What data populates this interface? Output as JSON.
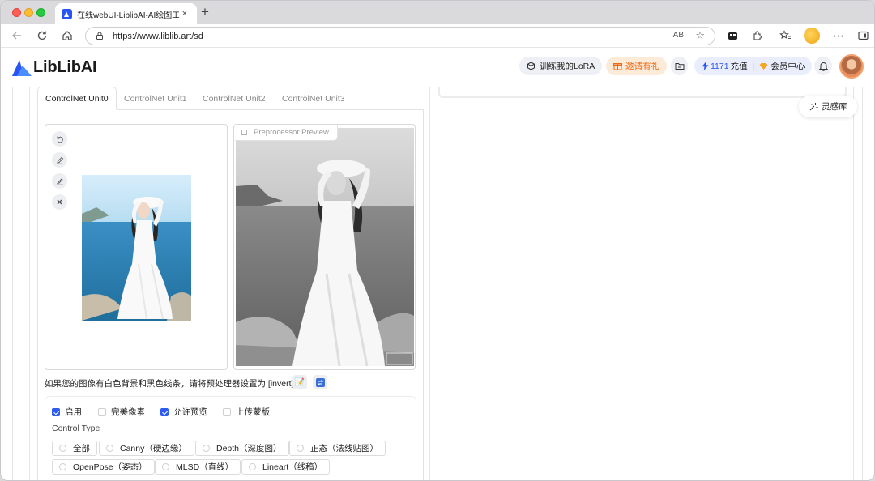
{
  "browser": {
    "tab_title": "在线webUI-LiblibAI-AI绘图工具",
    "tab_close": "×",
    "new_tab": "+",
    "url": "https://www.liblib.art/sd",
    "reader_mode": "AB"
  },
  "header": {
    "logo_text": "LibLibAI",
    "train_lora": "训练我的LoRA",
    "invite": "邀请有礼",
    "credits_value": "1171",
    "recharge": "充值",
    "member_center": "会员中心"
  },
  "inspiration_label": "灵感库",
  "controlnet": {
    "tabs": [
      "ControlNet Unit0",
      "ControlNet Unit1",
      "ControlNet Unit2",
      "ControlNet Unit3"
    ],
    "active_tab": 0,
    "preprocessor_preview_label": "Preprocessor Preview",
    "invert_hint": "如果您的图像有白色背景和黑色线条，请将预处理器设置为 [invert].",
    "options": {
      "enable": "启用",
      "pixel_perfect": "完美像素",
      "allow_preview": "允许预览",
      "upload_mask": "上传蒙版",
      "enable_checked": true,
      "pixel_perfect_checked": false,
      "allow_preview_checked": true,
      "upload_mask_checked": false
    },
    "control_type_label": "Control Type",
    "control_types": [
      "全部",
      "Canny（硬边缘）",
      "Depth（深度图）",
      "正态（法线贴图）",
      "OpenPose（姿态）",
      "MLSD（直线）",
      "Lineart（线稿）"
    ]
  },
  "colors": {
    "brand_blue": "#2755f5",
    "invite_orange": "#ee6a12",
    "checkbox_blue": "#2f5cf0"
  }
}
